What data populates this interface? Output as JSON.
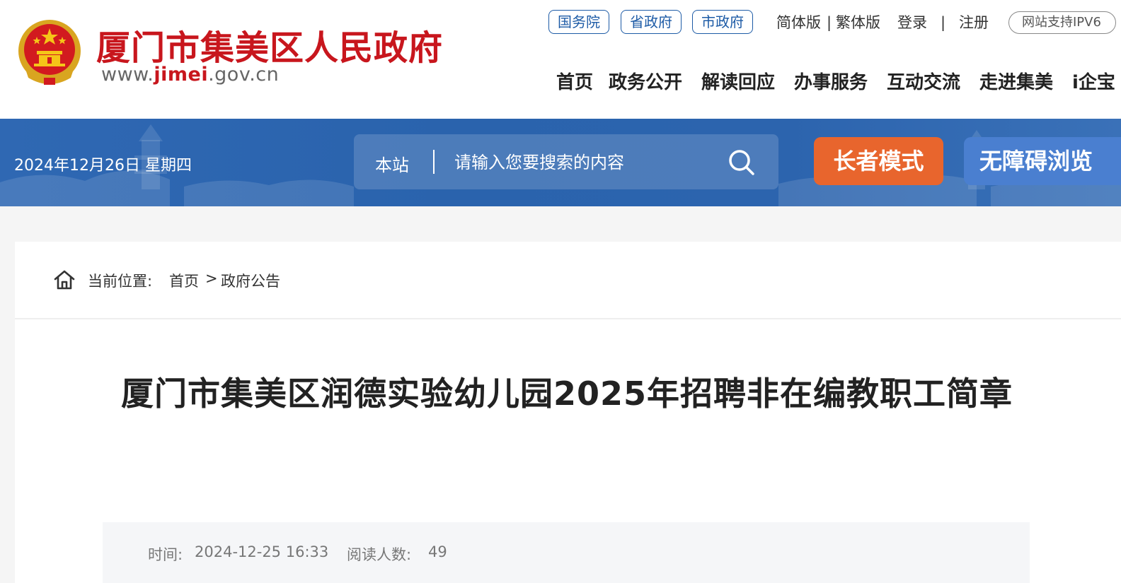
{
  "header": {
    "site_title": "厦门市集美区人民政府",
    "site_url_prefix": "www.",
    "site_url_highlight": "jimei",
    "site_url_suffix": ".gov.cn",
    "gov_links": [
      "国务院",
      "省政府",
      "市政府"
    ],
    "lang_simplified": "简体版",
    "lang_separator": "|",
    "lang_traditional": "繁体版",
    "login": "登录",
    "auth_separator": "|",
    "register": "注册",
    "ipv6_badge": "网站支持IPV6",
    "nav": [
      "首页",
      "政务公开",
      "解读回应",
      "办事服务",
      "互动交流",
      "走进集美",
      "i企宝"
    ]
  },
  "banner": {
    "date": "2024年12月26日 星期四",
    "search_scope": "本站",
    "search_placeholder": "请输入您要搜索的内容",
    "elder_mode": "长者模式",
    "accessible_mode": "无障碍浏览"
  },
  "breadcrumb": {
    "label": "当前位置:",
    "home": "首页",
    "separator": ">",
    "current": "政府公告"
  },
  "article": {
    "title": "厦门市集美区润德实验幼儿园2025年招聘非在编教职工简章",
    "time_label": "时间:",
    "time_value": "2024-12-25 16:33",
    "reads_label": "阅读人数:",
    "reads_value": "49"
  },
  "colors": {
    "brand_red": "#c8161d",
    "banner_blue": "#2c64ae",
    "elder_orange": "#e8652d",
    "link_blue": "#1d5ba6"
  }
}
